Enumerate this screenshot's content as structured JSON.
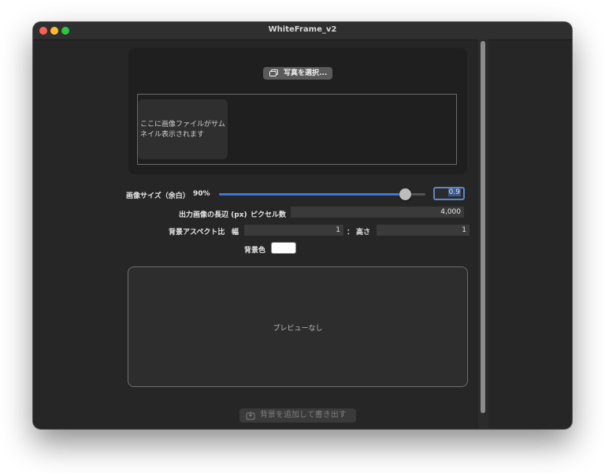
{
  "window": {
    "title": "WhiteFrame_v2"
  },
  "photo": {
    "select_button_label": "写真を選択...",
    "thumbnail_placeholder": "ここに画像ファイルがサムネイル表示されます"
  },
  "image_size": {
    "label": "画像サイズ（余白）",
    "percent_text": "90%",
    "value": "0.9",
    "slider_fraction": 0.9
  },
  "output": {
    "long_side_label": "出力画像の長辺 (px)",
    "pixel_count_label": "ピクセル数",
    "pixel_count_value": "4,000"
  },
  "aspect": {
    "label": "背景アスペクト比",
    "width_label": "幅",
    "width_value": "1",
    "separator": "：",
    "height_label": "高さ",
    "height_value": "1"
  },
  "background_color": {
    "label": "背景色",
    "value": "#ffffff"
  },
  "preview": {
    "empty_text": "プレビューなし"
  },
  "export": {
    "button_label": "背景を追加して書き出す"
  },
  "colors": {
    "accent": "#3b78d8",
    "window_bg": "#262626"
  }
}
